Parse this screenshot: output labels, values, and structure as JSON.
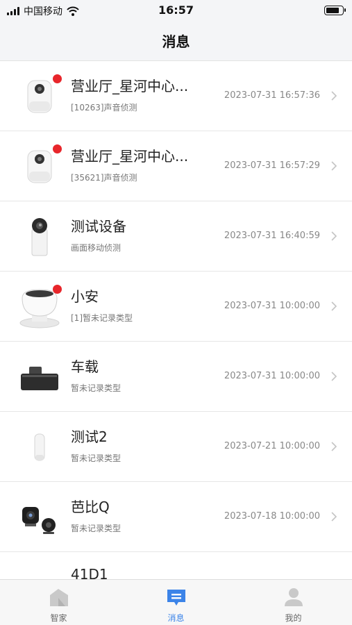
{
  "status_bar": {
    "carrier": "中国移动",
    "time": "16:57",
    "battery_level": 0.85,
    "icons": [
      "signal-icon",
      "wifi-icon",
      "battery-icon"
    ]
  },
  "header": {
    "title": "消息"
  },
  "colors": {
    "unread_dot": "#e8262b",
    "accent": "#3c84e8",
    "divider": "#e6e6e6"
  },
  "messages": [
    {
      "name": "营业厅_星河中心...",
      "subtitle": "[10263]声音侦测",
      "time": "2023-07-31 16:57:36",
      "unread": true,
      "device_icon": "ptz-camera-icon"
    },
    {
      "name": "营业厅_星河中心...",
      "subtitle": "[35621]声音侦测",
      "time": "2023-07-31 16:57:29",
      "unread": true,
      "device_icon": "ptz-camera-icon"
    },
    {
      "name": "测试设备",
      "subtitle": "画面移动侦测",
      "time": "2023-07-31 16:40:59",
      "unread": false,
      "device_icon": "bullet-camera-icon"
    },
    {
      "name": "小安",
      "subtitle": "[1]暂未记录类型",
      "time": "2023-07-31 10:00:00",
      "unread": true,
      "device_icon": "home-camera-icon"
    },
    {
      "name": "车载",
      "subtitle": "暂未记录类型",
      "time": "2023-07-31 10:00:00",
      "unread": false,
      "device_icon": "dashcam-icon"
    },
    {
      "name": "测试2",
      "subtitle": "暂未记录类型",
      "time": "2023-07-21 10:00:00",
      "unread": false,
      "device_icon": "mini-camera-icon"
    },
    {
      "name": "芭比Q",
      "subtitle": "暂未记录类型",
      "time": "2023-07-18 10:00:00",
      "unread": false,
      "device_icon": "spy-camera-icon"
    },
    {
      "name": "41D1",
      "subtitle": "",
      "time": "",
      "unread": false,
      "device_icon": ""
    }
  ],
  "tabs": [
    {
      "label": "智家",
      "icon": "home-icon",
      "active": false
    },
    {
      "label": "消息",
      "icon": "message-icon",
      "active": true
    },
    {
      "label": "我的",
      "icon": "profile-icon",
      "active": false
    }
  ]
}
